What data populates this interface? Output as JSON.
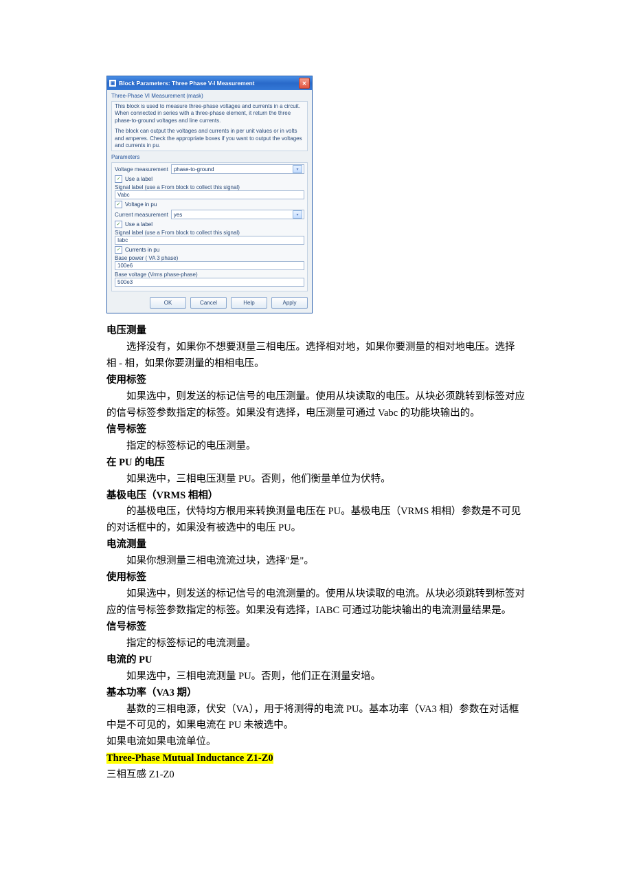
{
  "dialog": {
    "title": "Block Parameters: Three Phase V-I Measurement",
    "mask_label": "Three-Phase VI Measurement (mask)",
    "desc1": "This block is used to measure three-phase voltages and currents in a circuit. When connected in series with a  three-phase element, it return the three phase-to-ground voltages and line currents.",
    "desc2": "The block can output the voltages and currents in per unit values or in volts and amperes. Check the appropriate boxes if you want to output the voltages and currents in pu.",
    "parameters_label": "Parameters",
    "voltage_measurement_label": "Voltage measurement",
    "voltage_measurement_value": "phase-to-ground",
    "use_label_1": "Use a label",
    "signal_label_text_1": "Signal label  (use a From block to collect this signal)",
    "signal_value_1": "Vabc",
    "voltage_in_pu": "Voltage  in pu",
    "current_measurement_label": "Current measurement",
    "current_measurement_value": "yes",
    "use_label_2": "Use a label",
    "signal_label_text_2": "Signal label  (use a From block to collect this signal)",
    "signal_value_2": "Iabc",
    "currents_in_pu": "Currents in pu",
    "base_power_label": "Base power ( VA 3 phase)",
    "base_power_value": "100e6",
    "base_voltage_label": "Base voltage (Vrms phase-phase)",
    "base_voltage_value": "500e3",
    "buttons": {
      "ok": "OK",
      "cancel": "Cancel",
      "help": "Help",
      "apply": "Apply"
    }
  },
  "doc": {
    "h1": "电压测量",
    "p1": "选择没有，如果你不想要测量三相电压。选择相对地，如果你要测量的相对地电压。选择 相 - 相，如果你要测量的相相电压。",
    "h2": "使用标签",
    "p2": "如果选中，则发送的标记信号的电压测量。使用从块读取的电压。从块必须跳转到标签对应的信号标签参数指定的标签。如果没有选择，电压测量可通过 Vabc 的功能块输出的。",
    "h3": "信号标签",
    "p3": "指定的标签标记的电压测量。",
    "h4": "在 PU 的电压",
    "p4": "如果选中，三相电压测量 PU。否则，他们衡量单位为伏特。",
    "h5": "基极电压（VRMS 相相）",
    "p5": "的基极电压，伏特均方根用来转换测量电压在 PU。基极电压（VRMS 相相）参数是不可见的对话框中的，如果没有被选中的电压 PU。",
    "h6": "电流测量",
    "p6": "如果你想测量三相电流流过块，选择\"是\"。",
    "h7": "使用标签",
    "p7": "如果选中，则发送的标记信号的电流测量的。使用从块读取的电流。从块必须跳转到标签对应的信号标签参数指定的标签。如果没有选择，IABC 可通过功能块输出的电流测量结果是。",
    "h8": "信号标签",
    "p8": "指定的标签标记的电流测量。",
    "h9": "电流的 PU",
    "p9": "如果选中，三相电流测量 PU。否则，他们正在测量安培。",
    "h10": "基本功率（VA3 期）",
    "p10": "基数的三相电源，伏安（VA），用于将测得的电流 PU。基本功率（VA3 相）参数在对话框中是不可见的，如果电流在 PU 未被选中。",
    "p11": "如果电流如果电流单位。",
    "yellow": "Three-Phase Mutual Inductance Z1-Z0",
    "p12": "三相互感 Z1-Z0"
  }
}
